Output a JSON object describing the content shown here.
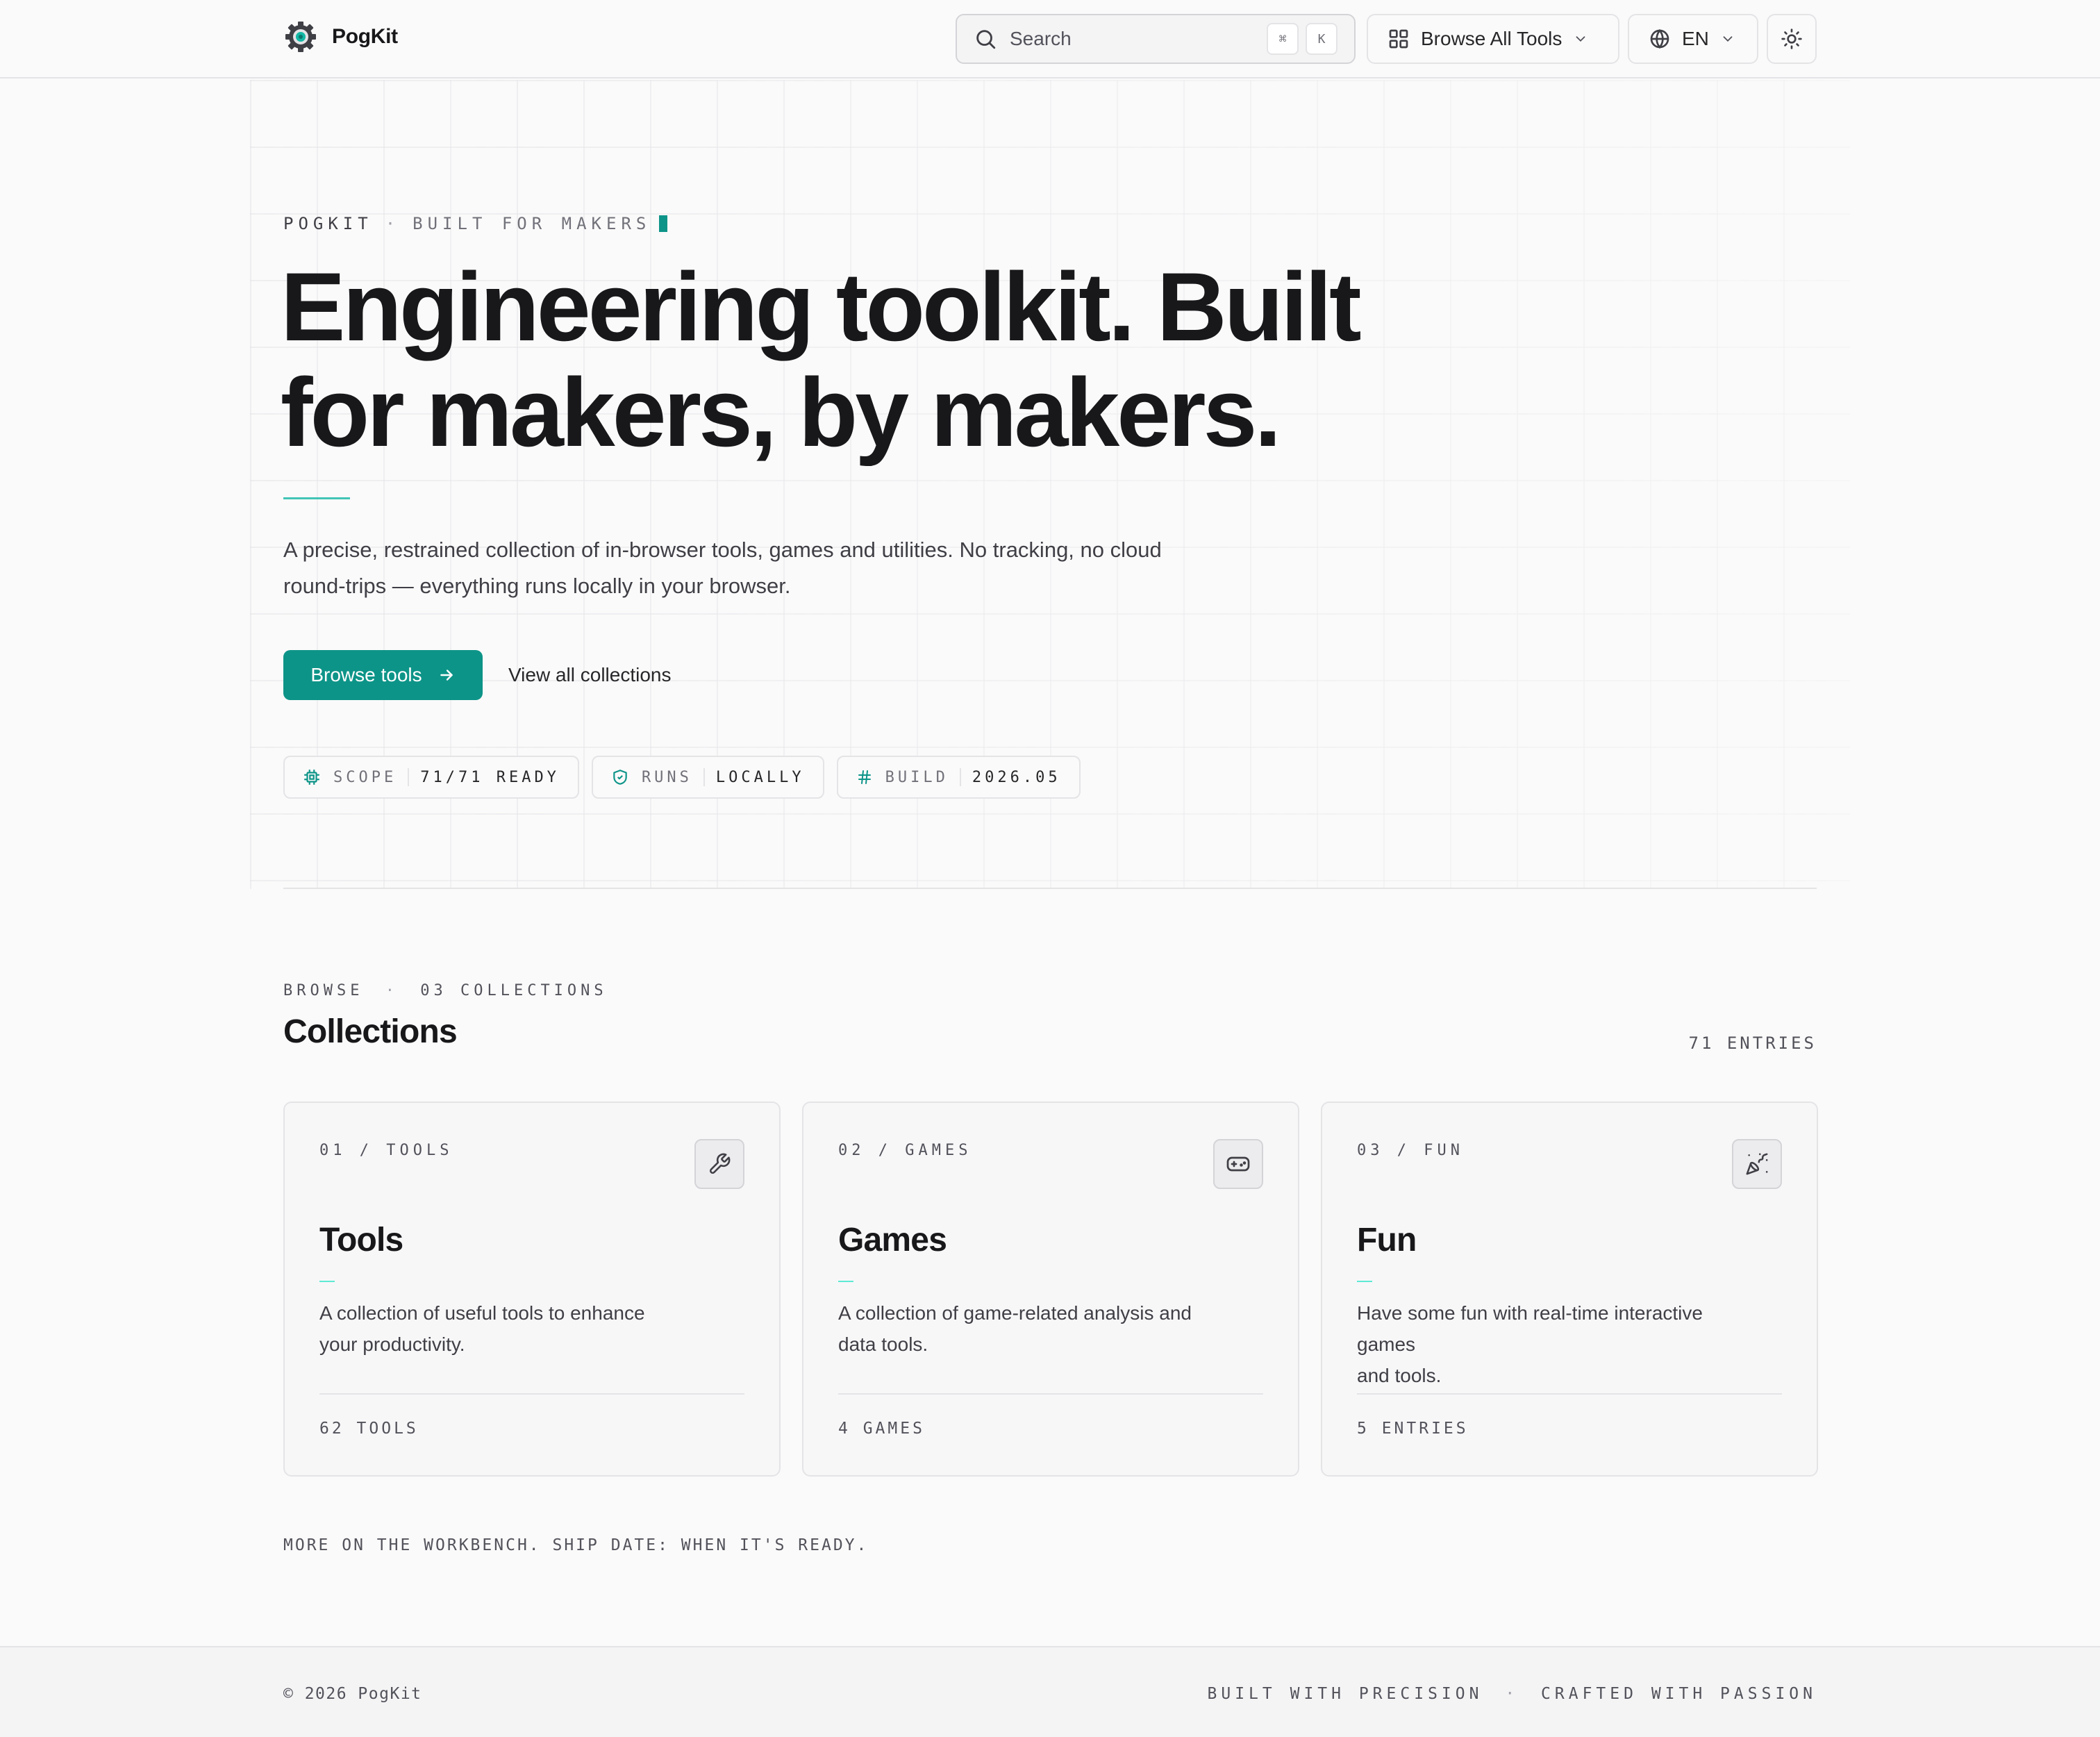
{
  "colors": {
    "accent": "#0d9488",
    "accent_light": "#14b8a6",
    "text": "#18181b",
    "muted": "#52525b",
    "border": "#e4e4e7",
    "background": "#fafafa"
  },
  "header": {
    "brand": "PogKit",
    "search": {
      "label": "Search",
      "shortcut": [
        "⌘",
        "K"
      ]
    },
    "browse_all_label": "Browse All Tools",
    "language_label": "EN",
    "icons": {
      "logo": "gear-logo",
      "search": "search-icon",
      "grid": "grid-icon",
      "globe": "globe-icon",
      "chevron": "chevron-down-icon",
      "theme": "sun-icon"
    }
  },
  "hero": {
    "eyebrow_primary": "POGKIT",
    "eyebrow_separator": "·",
    "eyebrow_secondary": "BUILT FOR MAKERS",
    "headline_line1": "Engineering toolkit. Built",
    "headline_line2": "for makers, by makers.",
    "lede_line1": "A precise, restrained collection of in-browser tools, games and utilities. No tracking, no cloud",
    "lede_line2": "round-trips — everything runs locally in your browser.",
    "primary_cta": "Browse tools",
    "secondary_cta": "View all collections",
    "chips": [
      {
        "key": "SCOPE",
        "value": "71/71 READY",
        "icon": "chip-icon"
      },
      {
        "key": "RUNS",
        "value": "LOCALLY",
        "icon": "shield-icon"
      },
      {
        "key": "BUILD",
        "value": "2026.05",
        "icon": "hash-icon"
      }
    ]
  },
  "collections": {
    "eyebrow_primary": "BROWSE",
    "eyebrow_separator": "·",
    "eyebrow_secondary": "03 COLLECTIONS",
    "title": "Collections",
    "entries_label": "71 ENTRIES",
    "cards": [
      {
        "label": "01 / TOOLS",
        "title": "Tools",
        "desc_line1": "A collection of useful tools to enhance",
        "desc_line2": "your productivity.",
        "count": "62 TOOLS",
        "icon": "wrench-icon"
      },
      {
        "label": "02 / GAMES",
        "title": "Games",
        "desc_line1": "A collection of game-related analysis and",
        "desc_line2": "data tools.",
        "count": "4 GAMES",
        "icon": "gamepad-icon"
      },
      {
        "label": "03 / FUN",
        "title": "Fun",
        "desc_line1": "Have some fun with real-time interactive games",
        "desc_line2": "and tools.",
        "count": "5 ENTRIES",
        "icon": "party-popper-icon"
      }
    ],
    "workbench_note": "MORE ON THE WORKBENCH. SHIP DATE: WHEN IT'S READY."
  },
  "footer": {
    "copyright": "© 2026 PogKit",
    "tagline_left": "BUILT WITH PRECISION",
    "tagline_separator": "·",
    "tagline_right": "CRAFTED WITH PASSION"
  }
}
